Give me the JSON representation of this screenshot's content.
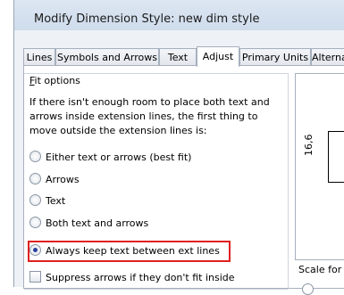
{
  "window": {
    "title": "Modify Dimension Style: new dim style"
  },
  "tabs": [
    {
      "label": "Lines"
    },
    {
      "label": "Symbols and Arrows"
    },
    {
      "label": "Text"
    },
    {
      "label": "Adjust",
      "active": true
    },
    {
      "label": "Primary Units"
    },
    {
      "label": "Alternate"
    }
  ],
  "fit_options": {
    "group_label_accel": "F",
    "group_label_rest": "it options",
    "description_lines": [
      "If there isn't enough room to place both text and",
      "arrows inside extension lines, the first thing to",
      "move outside the extension lines is:"
    ],
    "options": [
      {
        "label": "Either text or arrows (best fit)",
        "checked": false
      },
      {
        "label": "Arrows",
        "checked": false
      },
      {
        "label": "Text",
        "checked": false
      },
      {
        "label": "Both text and arrows",
        "checked": false
      },
      {
        "label": "Always keep text between ext lines",
        "checked": true
      }
    ],
    "suppress_label": "Suppress arrows if they don't fit inside"
  },
  "preview": {
    "dimension_text": "16,6"
  },
  "scale": {
    "label": "Scale for d"
  },
  "colors": {
    "highlight": "#e02020",
    "radio_dot": "#2b3f9e"
  }
}
